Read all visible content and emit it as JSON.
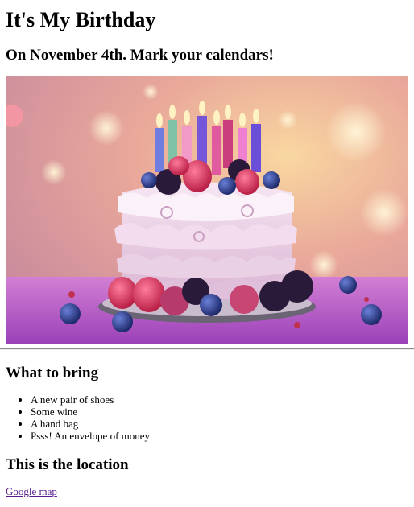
{
  "page": {
    "title": "It's My Birthday",
    "subtitle": "On November 4th. Mark your calendars!",
    "image_subject": "birthday cake with lit candles and berries"
  },
  "bring": {
    "heading": "What to bring",
    "items": [
      "A new pair of shoes",
      "Some wine",
      "A hand bag",
      "Psss! An envelope of money"
    ]
  },
  "location": {
    "heading": "This is the location",
    "link_label": "Google map"
  },
  "colors": {
    "link_visited": "#551a8b",
    "divider": "#8a8a8a"
  }
}
